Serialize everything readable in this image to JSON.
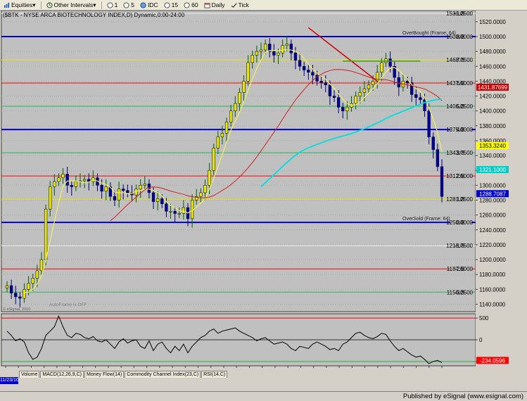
{
  "toolbar": {
    "equities_label": "Equities",
    "intervals_label": "Other Intervals",
    "buttons": [
      "1",
      "5",
      "IDC",
      "15",
      "60",
      "Daily",
      "Tick"
    ]
  },
  "chart_data": [
    {
      "type": "candlestick",
      "title": "($BTK - NYSE ARCA BIOTECHNOLOGY INDEX,D) Dynamic,0:00-24:00",
      "ylim": [
        1130,
        1535
      ],
      "x_tick_labels": [
        "06",
        "13",
        "20",
        "27",
        "03",
        "10",
        "18",
        "24",
        "31",
        "07",
        "14",
        "22",
        "28",
        "07",
        "14",
        "21",
        "28",
        "04",
        "11",
        "18",
        "25",
        "02",
        "09",
        "16",
        "23",
        "31",
        "06",
        "13",
        "20",
        "27",
        "05",
        "11",
        "18",
        "25",
        "01"
      ],
      "x_month_labels": [
        "Dec",
        "2011",
        "Feb",
        "Mar",
        "Apr",
        "May",
        "Jun",
        "Jul",
        "Aug"
      ],
      "y_tick_labels": [
        "1140.0000",
        "1160.0000",
        "1180.0000",
        "1200.0000",
        "1220.0000",
        "1240.0000",
        "1260.0000",
        "1280.0000",
        "1300.0000",
        "1320.0000",
        "1340.0000",
        "1360.0000",
        "1380.0000",
        "1400.0000",
        "1420.0000",
        "1440.0000",
        "1460.0000",
        "1480.0000",
        "1500.0000",
        "1520.0000"
      ],
      "murrey_levels": [
        {
          "label": "+1/8",
          "value": "1531.2500",
          "color": "#f0f0f0"
        },
        {
          "label": "8/8",
          "value": "1500.0000",
          "color": "#0000cc",
          "note": "OverBought (Frame: 64)"
        },
        {
          "label": "7/8",
          "value": "1468.7500",
          "color": "#e8e800"
        },
        {
          "label": "6/8",
          "value": "1437.5000",
          "color": "#ff0000"
        },
        {
          "label": "5/8",
          "value": "1406.2500",
          "color": "#30b060"
        },
        {
          "label": "4/8",
          "value": "1375.0000",
          "color": "#0000cc"
        },
        {
          "label": "3/8",
          "value": "1343.7500",
          "color": "#30b060"
        },
        {
          "label": "2/8",
          "value": "1312.5000",
          "color": "#ff0000"
        },
        {
          "label": "1/8",
          "value": "1281.2500",
          "color": "#e8e800"
        },
        {
          "label": "0/8",
          "value": "1250.0000",
          "color": "#0000cc",
          "note": "OverSold (Frame: 64)"
        },
        {
          "label": "-1/8",
          "value": "1218.7500",
          "color": "#f0f0f0"
        },
        {
          "label": "-2/8",
          "value": "1187.5000",
          "color": "#ff0000"
        },
        {
          "label": "-3/8",
          "value": "1156.2500",
          "color": "#30b060"
        }
      ],
      "price_tags": [
        {
          "value": "1431.87699",
          "color": "#cc0000",
          "text_color": "#ffffff"
        },
        {
          "value": "1353.3240",
          "color": "#ffff00",
          "text_color": "#000000"
        },
        {
          "value": "1321.1000",
          "color": "#00cccc",
          "text_color": "#ffffff"
        },
        {
          "value": "1288.7087",
          "color": "#0000cc",
          "text_color": "#ffffff"
        }
      ],
      "annotations": [
        "AutoFrame is OFF",
        "© eSignal, 2010"
      ],
      "series": [
        {
          "values": [
            1165,
            1155,
            1150,
            1148,
            1160,
            1168,
            1175,
            1185,
            1200,
            1268,
            1298,
            1305,
            1310,
            1315,
            1300,
            1298,
            1305,
            1306,
            1308,
            1305,
            1310,
            1300,
            1292,
            1298,
            1285,
            1280,
            1295,
            1293,
            1290,
            1287,
            1295,
            1300,
            1302,
            1290,
            1278,
            1282,
            1275,
            1265,
            1265,
            1262,
            1262,
            1270,
            1255,
            1280,
            1285,
            1290,
            1300,
            1320,
            1350,
            1365,
            1370,
            1385,
            1400,
            1410,
            1425,
            1440,
            1465,
            1475,
            1480,
            1482,
            1490,
            1480,
            1475,
            1478,
            1488,
            1490,
            1478,
            1468,
            1460,
            1455,
            1452,
            1448,
            1440,
            1438,
            1435,
            1420,
            1418,
            1405,
            1400,
            1405,
            1410,
            1420,
            1425,
            1430,
            1435,
            1440,
            1452,
            1465,
            1470,
            1460,
            1445,
            1432,
            1440,
            1438,
            1422,
            1418,
            1415,
            1400,
            1365,
            1348,
            1325,
            1285
          ]
        },
        {
          "name": "MACD(12,26,9,C)",
          "values": []
        },
        {
          "name": "Money Flow(14)",
          "values": []
        },
        {
          "name": "Commodity Channel Index(23,C)",
          "values": []
        },
        {
          "name": "RSI(14,C)",
          "values": []
        }
      ]
    },
    {
      "type": "line",
      "ylim": [
        -120,
        120
      ],
      "y_tick_labels": [
        "500",
        "0",
        "-500"
      ],
      "price_tags": [
        {
          "value": "-234.0596",
          "color": "#ff0000",
          "text_color": "#ffffff"
        }
      ],
      "series": [
        {
          "values": [
            40,
            20,
            -5,
            5,
            -10,
            -60,
            -90,
            -80,
            -40,
            20,
            40,
            60,
            110,
            60,
            20,
            10,
            30,
            25,
            10,
            5,
            15,
            -5,
            -10,
            0,
            -20,
            -40,
            -10,
            5,
            -15,
            -5,
            0,
            -30,
            -40,
            -5,
            -50,
            -20,
            -10,
            -40,
            -60,
            -30,
            -50,
            -20,
            -60,
            -30,
            -10,
            10,
            20,
            40,
            50,
            30,
            40,
            45,
            50,
            55,
            40,
            30,
            20,
            10,
            -5,
            5,
            10,
            -5,
            -20,
            -15,
            -10,
            -20,
            -40,
            -50,
            -30,
            -35,
            -40,
            -20,
            -10,
            -20,
            -30,
            -45,
            -40,
            -50,
            -20,
            -10,
            10,
            30,
            35,
            20,
            10,
            5,
            15,
            30,
            25,
            -5,
            -30,
            -50,
            -40,
            -55,
            -70,
            -80,
            -75,
            -90,
            -110,
            -100,
            -95,
            -105
          ]
        }
      ]
    }
  ],
  "tabs": [
    "Volume",
    "MACD(12,26,9,C)",
    "Money Flow(14)",
    "Commodity Channel Index(23,C)",
    "RSI(14,C)"
  ],
  "current_date": "11/23/10",
  "footer_text": "Published by eSignal (www.esignal.com)"
}
